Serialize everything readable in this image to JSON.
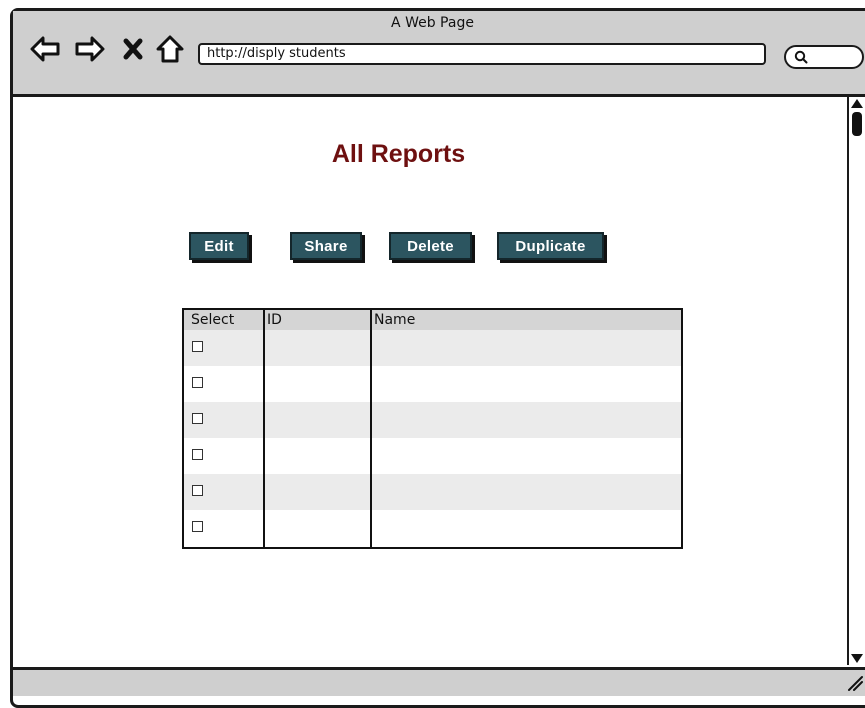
{
  "window": {
    "title": "A Web Page"
  },
  "browser": {
    "url": "http://disply students",
    "icons": [
      "back-arrow-icon",
      "forward-arrow-icon",
      "close-x-icon",
      "home-icon",
      "search-icon"
    ]
  },
  "page": {
    "title": "All Reports",
    "buttons": {
      "edit": "Edit",
      "share": "Share",
      "delete": "Delete",
      "duplicate": "Duplicate"
    },
    "table": {
      "columns": [
        "Select",
        "ID",
        "Name"
      ],
      "rows": [
        {
          "selected": false,
          "id": "",
          "name": ""
        },
        {
          "selected": false,
          "id": "",
          "name": ""
        },
        {
          "selected": false,
          "id": "",
          "name": ""
        },
        {
          "selected": false,
          "id": "",
          "name": ""
        },
        {
          "selected": false,
          "id": "",
          "name": ""
        },
        {
          "selected": false,
          "id": "",
          "name": ""
        }
      ]
    }
  },
  "colors": {
    "title": "#6e1010",
    "button_bg": "#2c5560",
    "chrome": "#cfcfcf",
    "row_alt": "#ebebeb"
  }
}
